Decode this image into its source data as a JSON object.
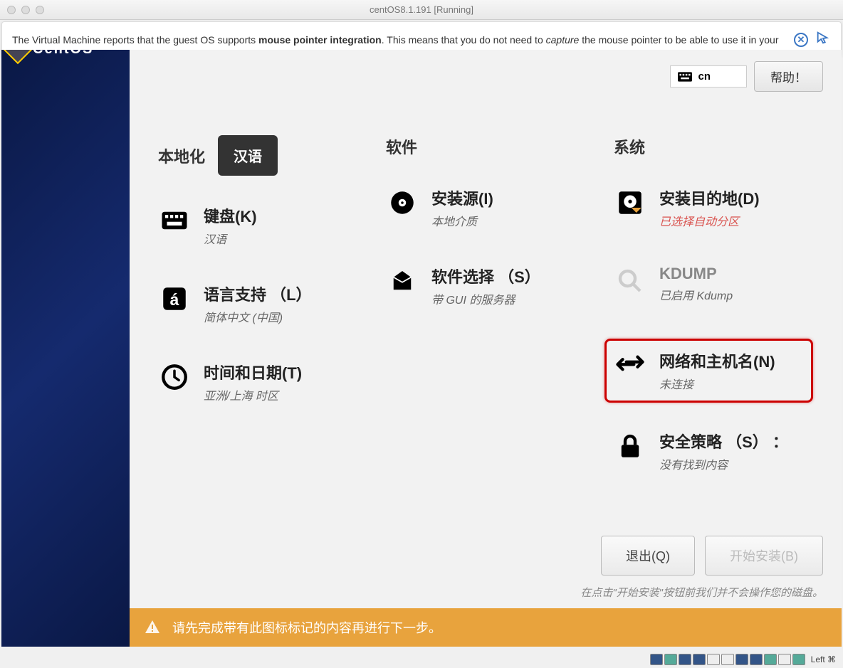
{
  "window": {
    "title": "centOS8.1.191 [Running]"
  },
  "infobar": {
    "pre": "The Virtual Machine reports that the guest OS supports ",
    "bold": "mouse pointer integration",
    "mid": ". This means that you do not need to ",
    "italic": "capture",
    "post": " the mouse pointer to be able to use it in your"
  },
  "logo_text": "CentOS",
  "keyboard_indicator": "cn",
  "help_button": "帮助！",
  "lang_badge": "汉语",
  "sections": {
    "localization": "本地化",
    "software": "软件",
    "system": "系统"
  },
  "items": {
    "keyboard": {
      "title": "键盘(K)",
      "sub": "汉语"
    },
    "language": {
      "title": "语言支持 （L）",
      "sub": "简体中文 (中国)"
    },
    "time": {
      "title": "时间和日期(T)",
      "sub": "亚洲/上海 时区"
    },
    "source": {
      "title": "安装源(I)",
      "sub": "本地介质"
    },
    "software": {
      "title": "软件选择 （S）",
      "sub": "带 GUI 的服务器"
    },
    "dest": {
      "title": "安装目的地(D)",
      "sub": "已选择自动分区"
    },
    "kdump": {
      "title": "KDUMP",
      "sub": "已启用 Kdump"
    },
    "network": {
      "title": "网络和主机名(N)",
      "sub": "未连接"
    },
    "security": {
      "title": "安全策略 （S） ：",
      "sub": "没有找到内容"
    }
  },
  "buttons": {
    "quit": "退出(Q)",
    "begin": "开始安装(B)"
  },
  "footer_note": "在点击\"开始安装\"按钮前我们并不会操作您的磁盘。",
  "warn_bar": "请先完成带有此图标标记的内容再进行下一步。",
  "status_hostkey": "Left ⌘"
}
